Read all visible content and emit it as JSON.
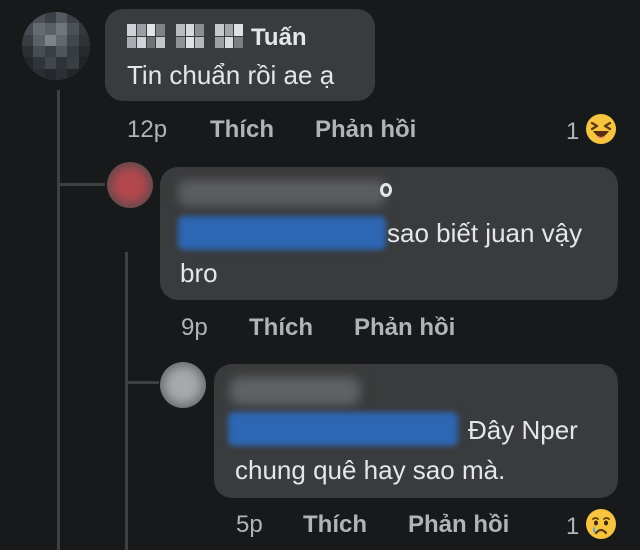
{
  "comments": [
    {
      "author_visible": "Tuấn",
      "text": "Tin chuẩn rồi ae ạ",
      "time": "12p",
      "like_label": "Thích",
      "reply_label": "Phản hồi",
      "reaction_count": "1",
      "reaction_icon": "laughing-emoji-icon"
    },
    {
      "author_visible": "",
      "text_line1": "sao biết juan vậy",
      "text_line2": "bro",
      "time": "9p",
      "like_label": "Thích",
      "reply_label": "Phản hồi"
    },
    {
      "author_visible": "",
      "text_line1": "Đây Nper",
      "text_line2": "chung quê hay sao mà.",
      "time": "5p",
      "like_label": "Thích",
      "reply_label": "Phản hồi",
      "reaction_count": "1",
      "reaction_icon": "sad-emoji-icon"
    }
  ],
  "colors": {
    "background": "#18191a",
    "bubble": "#3a3b3c",
    "text": "#e4e6eb",
    "meta": "#b0b3b8",
    "redaction_blue": "#2d66b3",
    "thread_line": "#3e4042"
  }
}
